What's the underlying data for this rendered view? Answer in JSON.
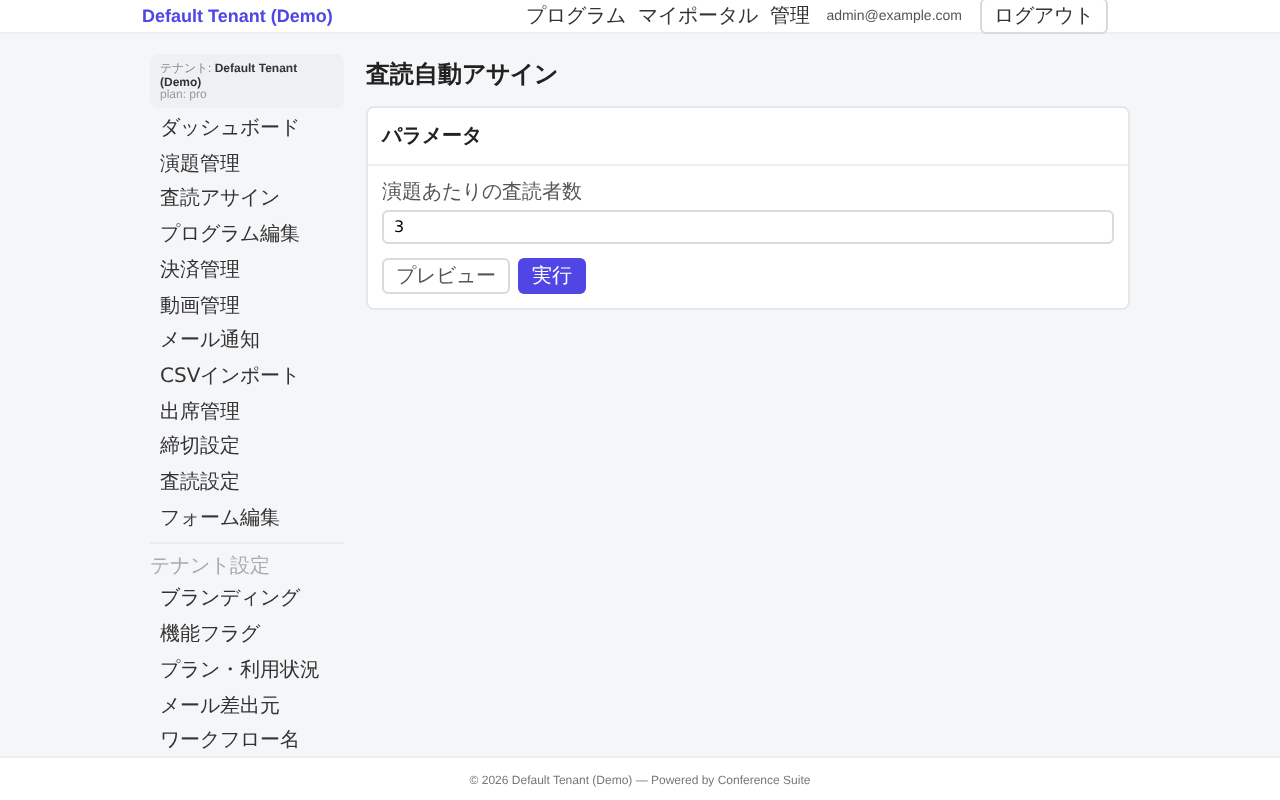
{
  "header": {
    "brand": "Default Tenant (Demo)",
    "nav": [
      "プログラム",
      "マイポータル",
      "管理"
    ],
    "user_email": "admin@example.com",
    "logout_button": "ログアウト"
  },
  "sidebar": {
    "tenant_label": "テナント: **Default Tenant (Demo)**",
    "plan": "plan: pro",
    "items": [
      {
        "label": "ダッシュボード",
        "selected": false
      },
      {
        "label": "演題管理",
        "selected": false
      },
      {
        "label": "査読アサイン",
        "selected": false
      },
      {
        "label": "プログラム編集",
        "selected": false
      },
      {
        "label": "決済管理",
        "selected": false
      },
      {
        "label": "動画管理",
        "selected": false
      },
      {
        "label": "メール通知",
        "selected": false
      },
      {
        "label": "CSVインポート",
        "selected": false
      },
      {
        "label": "出席管理",
        "selected": false
      },
      {
        "label": "締切設定",
        "selected": false
      },
      {
        "label": "査読設定",
        "selected": false
      },
      {
        "label": "フォーム編集",
        "selected": false
      }
    ],
    "section_title": "テナント設定",
    "section_items": [
      {
        "label": "ブランディング",
        "selected": false
      },
      {
        "label": "機能フラグ",
        "selected": false
      },
      {
        "label": "プラン・利用状況",
        "selected": false
      },
      {
        "label": "メール差出元",
        "selected": false
      },
      {
        "label": "ワークフロー名",
        "selected": false
      }
    ]
  },
  "page": {
    "title": "査読自動アサイン",
    "card": {
      "title": "パラメータ",
      "field_label": "演題あたりの査読者数",
      "field_value": "3",
      "buttons": [
        {
          "label": "プレビュー",
          "kind": "secondary"
        },
        {
          "label": "実行",
          "kind": "primary"
        }
      ]
    }
  },
  "footer": "© 2026 Default Tenant (Demo) — Powered by Conference Suite"
}
